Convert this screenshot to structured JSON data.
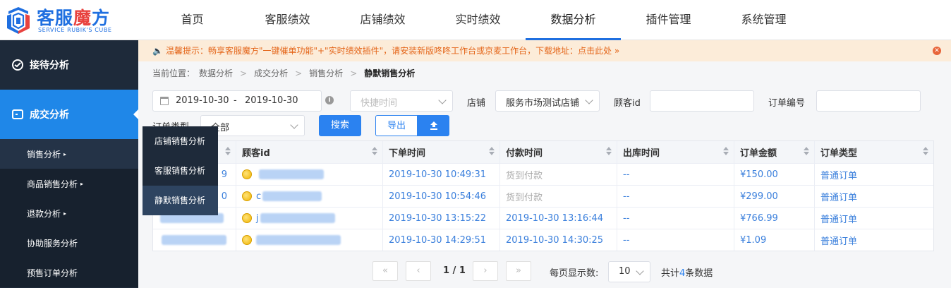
{
  "brand": {
    "title_main": "客服",
    "title_accent": "魔",
    "title_end": "方",
    "subtitle": "SERVICE RUBIK'S CUBE",
    "brand_color": "#1f6fe0",
    "accent_color": "#e8423f"
  },
  "top_nav": [
    {
      "label": "首页"
    },
    {
      "label": "客服绩效"
    },
    {
      "label": "店铺绩效"
    },
    {
      "label": "实时绩效"
    },
    {
      "label": "数据分析",
      "active": true
    },
    {
      "label": "插件管理"
    },
    {
      "label": "系统管理"
    }
  ],
  "sidebar": {
    "groups": [
      {
        "label": "接待分析",
        "icon": "reception-icon"
      },
      {
        "label": "成交分析",
        "icon": "deal-icon",
        "active": true
      }
    ],
    "subitems": [
      {
        "label": "销售分析",
        "arrow": "▸"
      },
      {
        "label": "商品销售分析",
        "arrow": "▸"
      },
      {
        "label": "退款分析",
        "arrow": "▸"
      },
      {
        "label": "协助服务分析",
        "arrow": ""
      },
      {
        "label": "预售订单分析",
        "arrow": ""
      }
    ]
  },
  "flyout": [
    {
      "label": "店铺销售分析"
    },
    {
      "label": "客服销售分析"
    },
    {
      "label": "静默销售分析",
      "active": true
    }
  ],
  "notice": {
    "text": "温馨提示：畅享客服魔方\"一键催单功能\"+\"实时绩效插件\"，请安装新版咚咚工作台或京麦工作台，下载地址：点击此处 »",
    "close": "✕"
  },
  "breadcrumb": {
    "prefix": "当前位置：",
    "items": [
      "数据分析",
      "成交分析",
      "销售分析"
    ],
    "current": "静默销售分析",
    "sep": ">"
  },
  "filters": {
    "date_start": "2019-10-30",
    "date_sep": "-",
    "date_end": "2019-10-30",
    "info_icon": "i",
    "quick_time_placeholder": "快捷时间",
    "shop_label": "店铺",
    "shop_value": "服务市场测试店铺",
    "customer_id_label": "顾客id",
    "customer_id_value": "",
    "order_no_label": "订单编号",
    "order_no_value": "",
    "order_type_label": "订单类型",
    "order_type_value": "全部",
    "search_button": "搜索",
    "export_button": "导出"
  },
  "table": {
    "columns": [
      "",
      "顾客id",
      "下单时间",
      "付款时间",
      "出库时间",
      "订单金额",
      "订单类型"
    ],
    "rows": [
      {
        "order_tail": "9",
        "customer_tail": "",
        "order_time": "2019-10-30 10:49:31",
        "pay_time": "货到付款",
        "out_time": "--",
        "amount": "¥150.00",
        "type": "普通订单"
      },
      {
        "order_tail": "0",
        "customer_tail": "c",
        "order_time": "2019-10-30 10:54:46",
        "pay_time": "货到付款",
        "out_time": "--",
        "amount": "¥299.00",
        "type": "普通订单"
      },
      {
        "order_tail": "",
        "customer_tail": "j",
        "order_time": "2019-10-30 13:15:22",
        "pay_time": "2019-10-30 13:16:44",
        "out_time": "--",
        "amount": "¥766.99",
        "type": "普通订单"
      },
      {
        "order_tail": "",
        "customer_tail": "",
        "order_time": "2019-10-30 14:29:51",
        "pay_time": "2019-10-30 14:30:25",
        "out_time": "--",
        "amount": "¥1.09",
        "type": "普通订单"
      }
    ]
  },
  "pagination": {
    "first": "«",
    "prev": "‹",
    "page_info": "1 / 1",
    "next": "›",
    "last": "»",
    "per_page_label": "每页显示数:",
    "per_page_value": "10",
    "total_prefix": "共计",
    "total_count": "4",
    "total_suffix": "条数据"
  }
}
